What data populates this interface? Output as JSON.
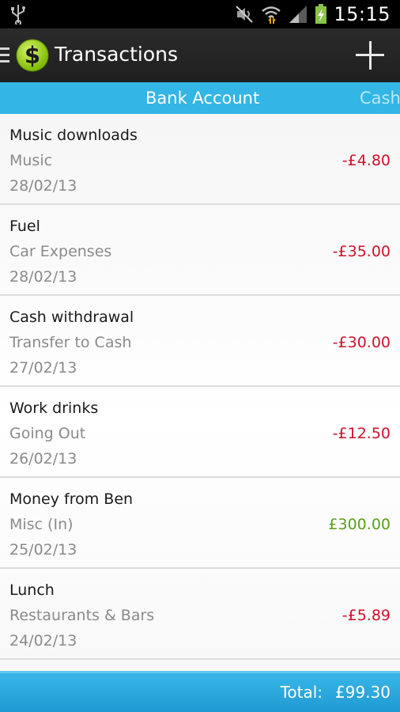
{
  "status_bar": {
    "time": "15:15",
    "icons": [
      "usb-icon",
      "mute-icon",
      "wifi-icon",
      "signal-icon",
      "battery-charging-icon"
    ]
  },
  "action_bar": {
    "title": "Transactions",
    "logo_symbol": "$",
    "add_icon": "plus-icon"
  },
  "tabs": {
    "active": "Bank Account",
    "next": "Cash",
    "color": "#33b5e5"
  },
  "transactions": [
    {
      "description": "Music downloads",
      "category": "Music",
      "date": "28/02/13",
      "amount": "-£4.80"
    },
    {
      "description": "Fuel",
      "category": "Car Expenses",
      "date": "28/02/13",
      "amount": "-£35.00"
    },
    {
      "description": "Cash withdrawal",
      "category": "Transfer to Cash",
      "date": "27/02/13",
      "amount": "-£30.00"
    },
    {
      "description": "Work drinks",
      "category": "Going Out",
      "date": "26/02/13",
      "amount": "-£12.50"
    },
    {
      "description": "Money from Ben",
      "category": "Misc (In)",
      "date": "25/02/13",
      "amount": "£300.00"
    },
    {
      "description": "Lunch",
      "category": "Restaurants & Bars",
      "date": "24/02/13",
      "amount": "-£5.89"
    }
  ],
  "footer": {
    "total_label": "Total:",
    "total_value": "£99.30"
  },
  "colors": {
    "negative": "#d0102a",
    "positive": "#5a9e1a",
    "accent": "#33b5e5"
  }
}
